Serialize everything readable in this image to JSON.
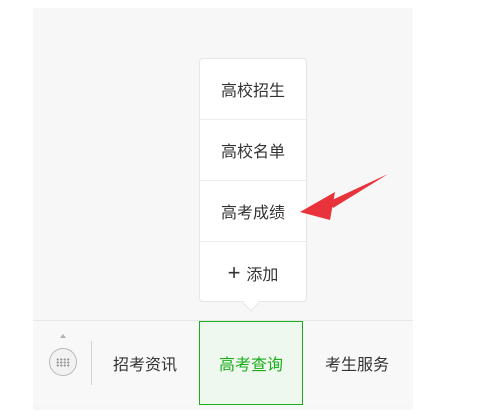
{
  "menu_popup": {
    "items": [
      {
        "label": "高校招生"
      },
      {
        "label": "高校名单"
      },
      {
        "label": "高考成绩"
      },
      {
        "label": "添加",
        "icon": "plus-icon"
      }
    ]
  },
  "bottom_bar": {
    "keyboard_icon": "keyboard-icon",
    "tabs": [
      {
        "label": "招考资讯"
      },
      {
        "label": "高考查询",
        "active": true
      },
      {
        "label": "考生服务"
      }
    ]
  },
  "annotation": {
    "color": "#e8333a"
  },
  "colors": {
    "accent": "#1aad19",
    "text": "#333333"
  }
}
